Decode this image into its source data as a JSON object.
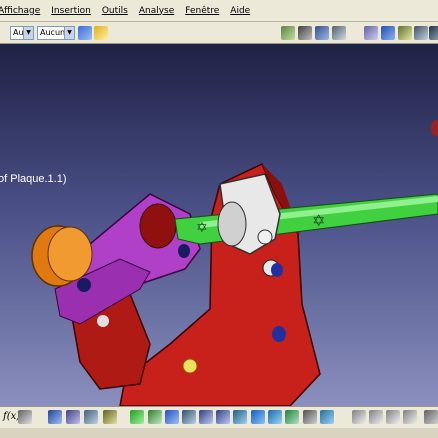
{
  "menubar": {
    "items": [
      "Affichage",
      "Insertion",
      "Outils",
      "Analyse",
      "Fenêtre",
      "Aide"
    ]
  },
  "toolbar": {
    "layer_value": "Aul",
    "filter_value": "Aucun"
  },
  "viewport": {
    "tree_label": "of Plaque.1.1)"
  },
  "bottombar": {
    "formula_label": "f(x)"
  },
  "colors": {
    "part_red": "#c8201a",
    "part_magenta": "#b040c8",
    "part_orange": "#e07a10",
    "shaft_green": "#40d040",
    "collar_white": "#e8e8e8",
    "hole_blue": "#2030a0",
    "screw_yellow": "#f0e060"
  }
}
